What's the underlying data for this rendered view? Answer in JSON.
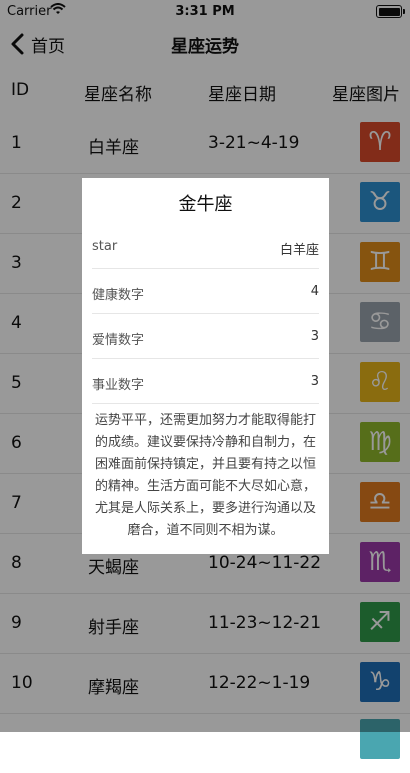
{
  "status": {
    "carrier": "Carrier",
    "time": "3:31 PM"
  },
  "nav": {
    "back_label": "首页",
    "title": "星座运势"
  },
  "table": {
    "headers": [
      "ID",
      "星座名称",
      "星座日期",
      "星座图片"
    ],
    "rows": [
      {
        "id": "1",
        "name": "白羊座",
        "date": "3-21~4-19",
        "glyph": "♈",
        "color": "#d94a2b"
      },
      {
        "id": "2",
        "name": "",
        "date": "",
        "glyph": "♉",
        "color": "#2d8fd0"
      },
      {
        "id": "3",
        "name": "",
        "date": "",
        "glyph": "♊",
        "color": "#e08d1a"
      },
      {
        "id": "4",
        "name": "",
        "date": "",
        "glyph": "♋",
        "color": "#9aa3ad"
      },
      {
        "id": "5",
        "name": "",
        "date": "",
        "glyph": "♌",
        "color": "#e6b419"
      },
      {
        "id": "6",
        "name": "",
        "date": "",
        "glyph": "♍",
        "color": "#8fb82c"
      },
      {
        "id": "7",
        "name": "",
        "date": "",
        "glyph": "♎",
        "color": "#e07a1f"
      },
      {
        "id": "8",
        "name": "天蝎座",
        "date": "10-24~11-22",
        "glyph": "♏",
        "color": "#9b3aa8"
      },
      {
        "id": "9",
        "name": "射手座",
        "date": "11-23~12-21",
        "glyph": "♐",
        "color": "#2f9a4a"
      },
      {
        "id": "10",
        "name": "摩羯座",
        "date": "12-22~1-19",
        "glyph": "♑",
        "color": "#1f6fb8"
      }
    ]
  },
  "modal": {
    "title": "金牛座",
    "items": [
      {
        "key": "star",
        "value": "白羊座"
      },
      {
        "key": "健康数字",
        "value": "4"
      },
      {
        "key": "爱情数字",
        "value": "3"
      },
      {
        "key": "事业数字",
        "value": "3"
      }
    ],
    "description": "运势平平，还需更加努力才能取得能打的成绩。建议要保持冷静和自制力，在困难面前保持镇定，并且要有持之以恒的精神。生活方面可能不大尽如心意，尤其是人际关系上，要多进行沟通以及磨合，道不同则不相为谋。"
  }
}
